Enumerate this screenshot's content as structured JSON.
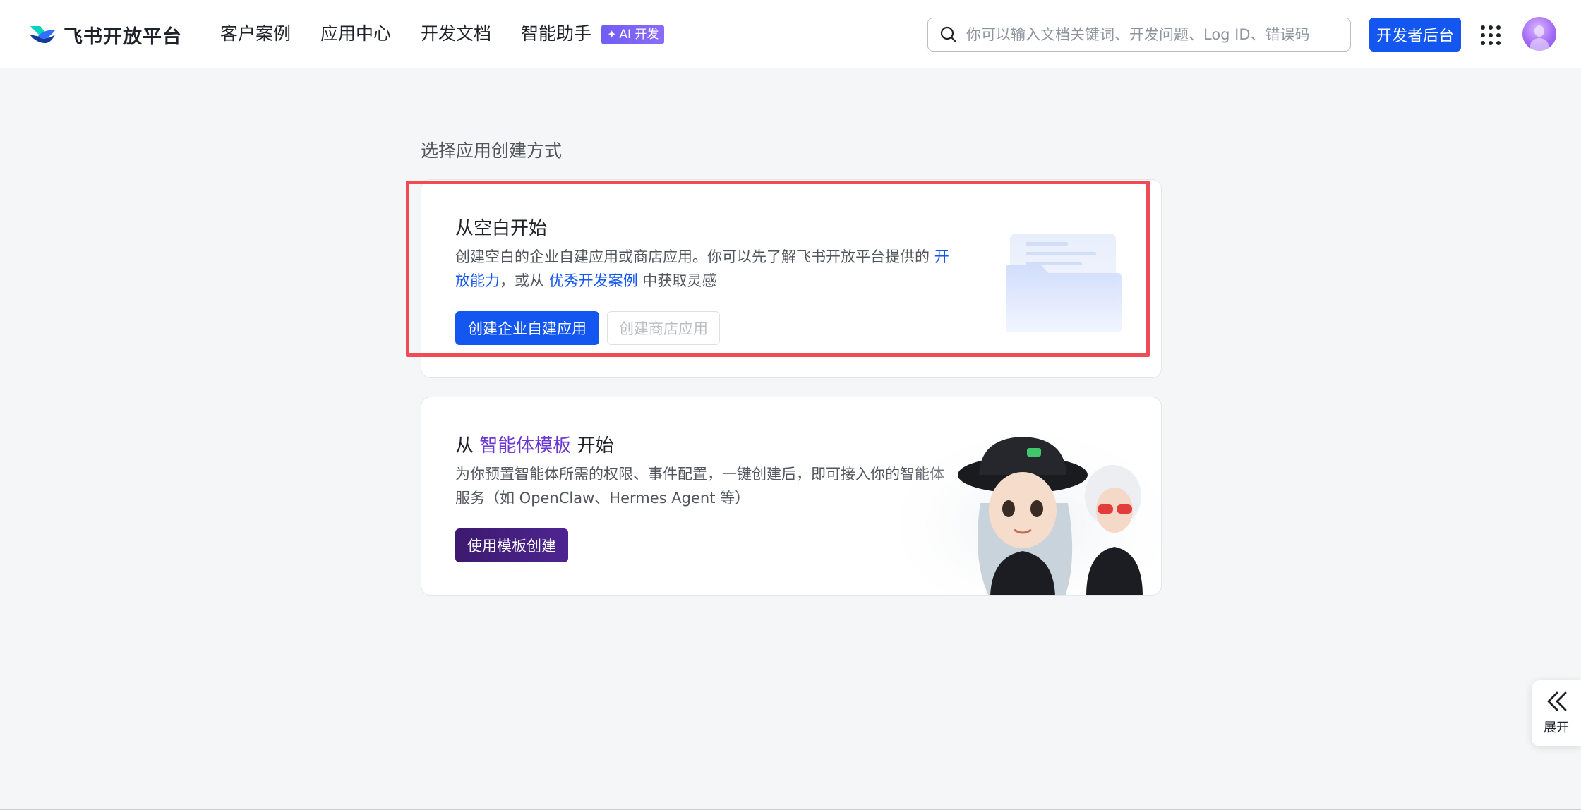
{
  "header": {
    "logo_text": "飞书开放平台",
    "nav": [
      "客户案例",
      "应用中心",
      "开发文档",
      "智能助手"
    ],
    "ai_badge": "AI 开发",
    "search_placeholder": "你可以输入文档关键词、开发问题、Log ID、错误码",
    "dev_button": "开发者后台"
  },
  "main": {
    "section_title": "选择应用创建方式",
    "blank_card": {
      "title": "从空白开始",
      "desc_prefix": "创建空白的企业自建应用或商店应用。你可以先了解飞书开放平台提供的 ",
      "link_capability": "开放能力",
      "desc_middle": "，或从 ",
      "link_cases": "优秀开发案例",
      "desc_suffix": " 中获取灵感",
      "btn_create_enterprise": "创建企业自建应用",
      "btn_create_store": "创建商店应用"
    },
    "template_card": {
      "title_prefix": "从 ",
      "title_highlight": "智能体模板",
      "title_suffix": " 开始",
      "desc": "为你预置智能体所需的权限、事件配置，一键创建后，即可接入你的智能体服务（如 OpenClaw、Hermes Agent 等）",
      "btn_use_template": "使用模板创建"
    }
  },
  "side": {
    "expand_label": "展开"
  },
  "colors": {
    "primary": "#1456f0",
    "purple": "#4e2590",
    "highlight_border": "#f04c55"
  }
}
